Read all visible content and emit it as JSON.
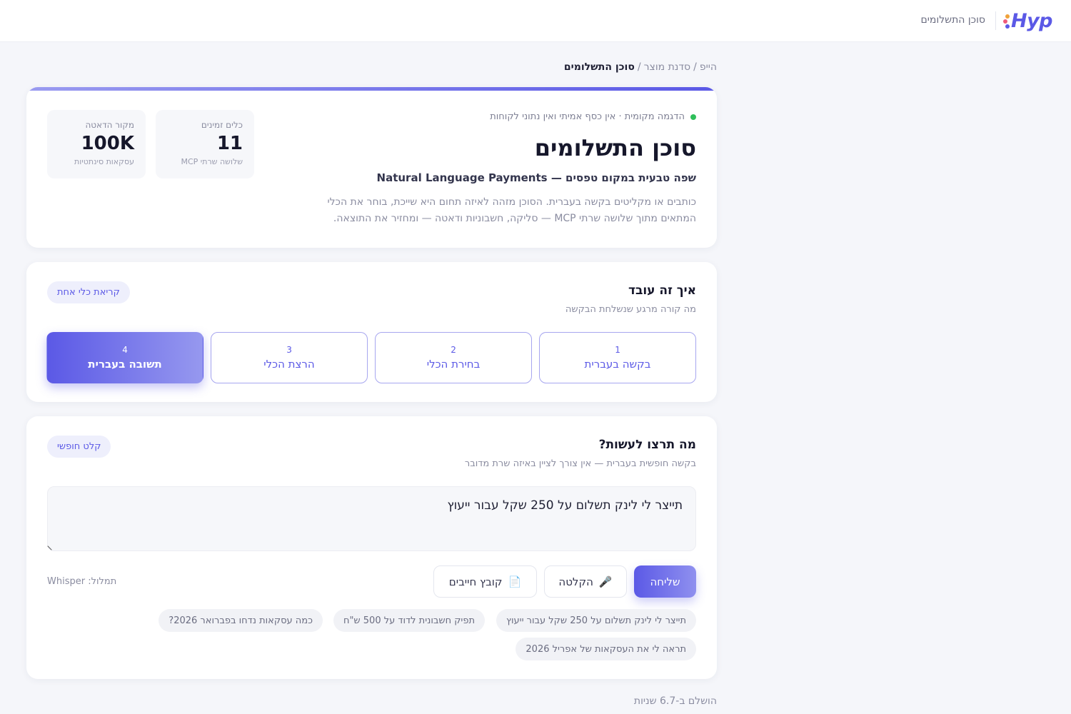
{
  "colors": {
    "accent": "#5b59e6",
    "accent_light": "#9698ef",
    "status_green": "#2fbf5a",
    "page_bg": "#f5f6fa"
  },
  "topbar": {
    "brand": "Hyp",
    "title": "סוכן התשלומים"
  },
  "breadcrumb": {
    "items": [
      "הייפ",
      "סדנת מוצר"
    ],
    "separator": "/",
    "current": "סוכן התשלומים"
  },
  "hero": {
    "status": "הדגמה מקומית · אין כסף אמיתי ואין נתוני לקוחות",
    "title": "סוכן התשלומים",
    "subtitle": "שפה טבעית במקום טפסים — Natural Language Payments",
    "description": "כותבים או מקליטים בקשה בעברית. הסוכן מזהה לאיזה תחום היא שייכת, בוחר את הכלי המתאים מתוך שלושה שרתי MCP — סליקה, חשבוניות ודאטה — ומחזיר את התוצאה.",
    "stats": [
      {
        "label": "כלים זמינים",
        "value": "11",
        "sub": "שלושה שרתי MCP"
      },
      {
        "label": "מקור הדאטה",
        "value": "100K",
        "sub": "עסקאות סינתטיות"
      }
    ]
  },
  "how": {
    "title": "איך זה עובד",
    "subtitle": "מה קורה מרגע שנשלחת הבקשה",
    "pill": "קריאת כלי אחת",
    "steps": [
      {
        "num": "1",
        "label": "בקשה בעברית"
      },
      {
        "num": "2",
        "label": "בחירת הכלי"
      },
      {
        "num": "3",
        "label": "הרצת הכלי"
      },
      {
        "num": "4",
        "label": "תשובה בעברית"
      }
    ],
    "active_step": 4
  },
  "query": {
    "title": "מה תרצו לעשות?",
    "subtitle": "בקשה חופשית בעברית — אין צורך לציין באיזה שרת מדובר",
    "pill": "קלט חופשי",
    "input_value": "תייצר לי לינק תשלום על 250 שקל עבור ייעוץ",
    "send_label": "שליחה",
    "record_label": "הקלטה",
    "file_label": "קובץ חייבים",
    "transcription": "תמלול: Whisper",
    "examples": [
      "תייצר לי לינק תשלום על 250 שקל עבור ייעוץ",
      "תפיק חשבונית לדוד על 500 ש\"ח",
      "כמה עסקאות נדחו בפברואר 2026?",
      "תראה לי את העסקאות של אפריל 2026"
    ]
  },
  "footer": {
    "elapsed": "הושלם ב-6.7 שניות"
  }
}
